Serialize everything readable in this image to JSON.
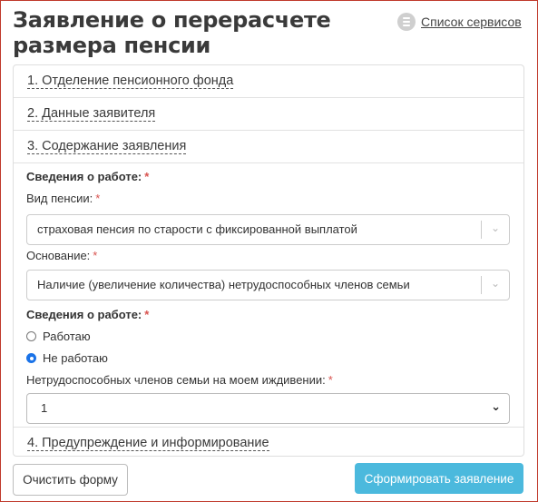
{
  "page": {
    "title": "Заявление о перерасчете размера пенсии",
    "services_link": "Список сервисов",
    "services_icon": "list-icon"
  },
  "sections": [
    {
      "label": "1. Отделение пенсионного фонда"
    },
    {
      "label": "2. Данные заявителя"
    },
    {
      "label": "3. Содержание заявления"
    },
    {
      "label": "4. Предупреждение и информирование"
    }
  ],
  "form": {
    "work_info_label": "Сведения о работе:",
    "pension_type_label": "Вид пенсии:",
    "pension_type_value": "страховая пенсия по старости с фиксированной выплатой",
    "basis_label": "Основание:",
    "basis_value": "Наличие (увеличение количества) нетрудоспособных членов семьи",
    "work_status_label": "Сведения о работе:",
    "work_status_options": [
      {
        "label": "Работаю",
        "selected": false
      },
      {
        "label": "Не работаю",
        "selected": true
      }
    ],
    "dependents_label": "Нетрудоспособных членов семьи на моем иждивении:",
    "dependents_value": "1",
    "required_mark": "*"
  },
  "buttons": {
    "clear": "Очистить форму",
    "submit": "Сформировать заявление"
  },
  "colors": {
    "accent": "#4bb9dd",
    "required": "#d9534f",
    "radio_selected": "#1a73e8"
  }
}
